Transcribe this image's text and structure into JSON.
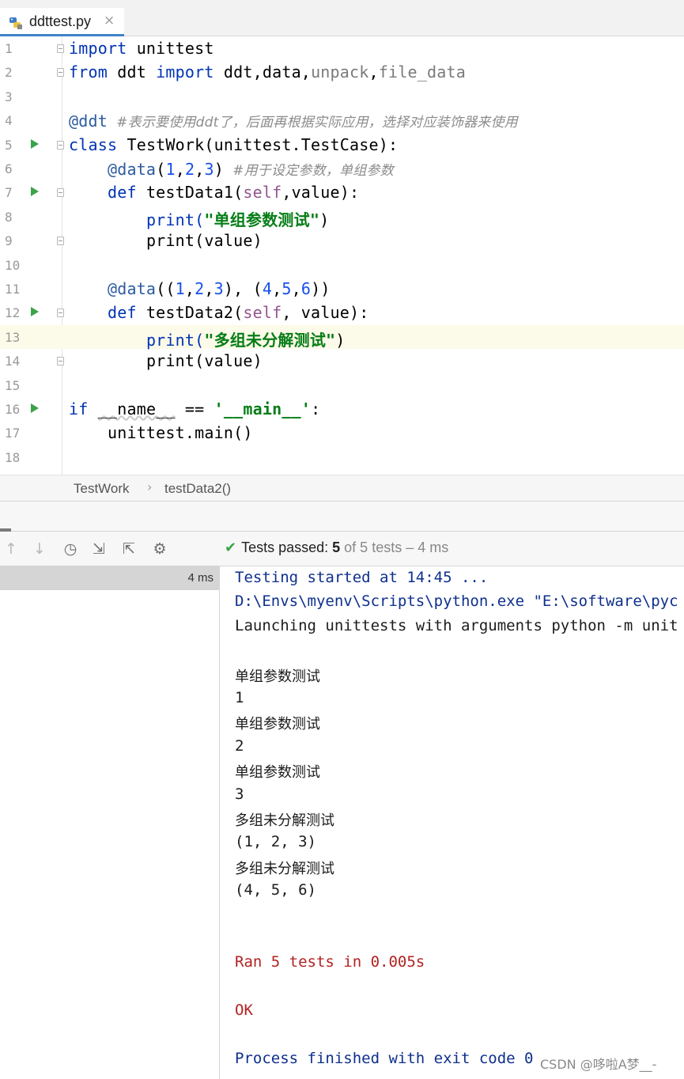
{
  "tab": {
    "filename": "ddttest.py",
    "close": "×"
  },
  "editor": {
    "line_numbers": [
      "1",
      "2",
      "3",
      "4",
      "5",
      "6",
      "7",
      "8",
      "9",
      "10",
      "11",
      "12",
      "13",
      "14",
      "15",
      "16",
      "17",
      "18"
    ],
    "lines": {
      "l1": {
        "kw": "import",
        "rest": " unittest"
      },
      "l2": {
        "kw1": "from",
        "mod": " ddt ",
        "kw2": "import",
        "a": " ddt,data,",
        "b": "unpack",
        "c": ",",
        "d": "file_data"
      },
      "l4": {
        "dec": "@ddt",
        "comment": "  #表示要使用ddt了，后面再根据实际应用，选择对应装饰器来使用"
      },
      "l5": {
        "kw": "class",
        "rest": " TestWork(unittest.TestCase):"
      },
      "l6": {
        "dec": "@data",
        "p1": "(",
        "n1": "1",
        "c1": ",",
        "n2": "2",
        "c2": ",",
        "n3": "3",
        "p2": ")",
        "comment": "  #用于设定参数，单组参数"
      },
      "l7": {
        "kw": "def",
        "name": " testData1(",
        "self": "self",
        "rest": ",value):"
      },
      "l8": {
        "fn": "print(",
        "str": "\"单组参数测试\"",
        "end": ")"
      },
      "l9": {
        "text": "print(value)"
      },
      "l11": {
        "dec": "@data",
        "a": "((",
        "n1": "1",
        "c1": ",",
        "n2": "2",
        "c2": ",",
        "n3": "3",
        "b": "), (",
        "n4": "4",
        "c3": ",",
        "n5": "5",
        "c4": ",",
        "n6": "6",
        "d": "))"
      },
      "l12": {
        "kw": "def",
        "name": " testData2(",
        "self": "self",
        "rest": ", value):"
      },
      "l13": {
        "fn": "print(",
        "str": "\"多组未分解测试\"",
        "end": ")"
      },
      "l14": {
        "text": "print(value)"
      },
      "l16": {
        "kw": "if",
        "a": " ",
        "name": "__name__",
        "b": " == ",
        "str": "'__main__'",
        "c": ":"
      },
      "l17": {
        "text": "unittest.main()"
      }
    }
  },
  "breadcrumb": {
    "class": "TestWork",
    "sep": "›",
    "method": "testData2()"
  },
  "run_panel": {
    "status": {
      "check": "✔",
      "label": "Tests passed: ",
      "passed": "5",
      "of": " of 5 tests – 4 ms"
    },
    "toolbar_icons": [
      "arrow-up-icon",
      "arrow-down-icon",
      "history-icon",
      "import-icon",
      "export-icon",
      "gear-icon"
    ],
    "tree_time": "4 ms",
    "console": [
      {
        "text": "Testing started at 14:45 ...",
        "style": "blue"
      },
      {
        "text": "D:\\Envs\\myenv\\Scripts\\python.exe \"E:\\software\\pyc",
        "style": "blue"
      },
      {
        "text": "Launching unittests with arguments python -m unit",
        "style": "normal"
      },
      {
        "text": "",
        "style": "normal"
      },
      {
        "text": "单组参数测试",
        "style": "cjk"
      },
      {
        "text": "1",
        "style": "normal"
      },
      {
        "text": "单组参数测试",
        "style": "cjk"
      },
      {
        "text": "2",
        "style": "normal"
      },
      {
        "text": "单组参数测试",
        "style": "cjk"
      },
      {
        "text": "3",
        "style": "normal"
      },
      {
        "text": "多组未分解测试",
        "style": "cjk"
      },
      {
        "text": "(1, 2, 3)",
        "style": "normal"
      },
      {
        "text": "多组未分解测试",
        "style": "cjk"
      },
      {
        "text": "(4, 5, 6)",
        "style": "normal"
      },
      {
        "text": "",
        "style": "normal"
      },
      {
        "text": "",
        "style": "normal"
      },
      {
        "text": "Ran 5 tests in 0.005s",
        "style": "red"
      },
      {
        "text": "",
        "style": "normal"
      },
      {
        "text": "OK",
        "style": "red"
      },
      {
        "text": "",
        "style": "normal"
      },
      {
        "text": "Process finished with exit code 0",
        "style": "blue"
      }
    ]
  },
  "watermark": "CSDN @哆啦A梦__-",
  "colors": {
    "keyword": "#0033b3",
    "string": "#067d17",
    "run_green": "#3aa34a",
    "current_line": "#fcfae8"
  }
}
